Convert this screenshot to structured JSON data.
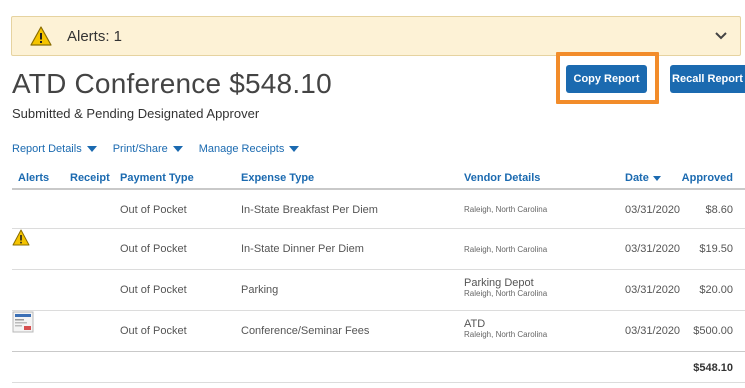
{
  "alerts": {
    "label": "Alerts: 1"
  },
  "report": {
    "title": "ATD Conference $548.10",
    "status": "Submitted & Pending Designated Approver"
  },
  "actions": {
    "copy": "Copy Report",
    "recall": "Recall Report"
  },
  "menus": [
    "Report Details",
    "Print/Share",
    "Manage Receipts"
  ],
  "columns": {
    "alerts": "Alerts",
    "receipt": "Receipt",
    "payment_type": "Payment Type",
    "expense_type": "Expense Type",
    "vendor": "Vendor Details",
    "date": "Date",
    "approved": "Approved"
  },
  "rows": [
    {
      "payment_type": "Out of Pocket",
      "expense_type": "In-State Breakfast Per Diem",
      "vendor_name": "",
      "vendor_loc": "Raleigh, North Carolina",
      "date": "03/31/2020",
      "amount": "$8.60"
    },
    {
      "payment_type": "Out of Pocket",
      "expense_type": "In-State Dinner Per Diem",
      "vendor_name": "",
      "vendor_loc": "Raleigh, North Carolina",
      "date": "03/31/2020",
      "amount": "$19.50"
    },
    {
      "payment_type": "Out of Pocket",
      "expense_type": "Parking",
      "vendor_name": "Parking Depot",
      "vendor_loc": "Raleigh, North Carolina",
      "date": "03/31/2020",
      "amount": "$20.00"
    },
    {
      "payment_type": "Out of Pocket",
      "expense_type": "Conference/Seminar Fees",
      "vendor_name": "ATD",
      "vendor_loc": "Raleigh, North Carolina",
      "date": "03/31/2020",
      "amount": "$500.00"
    }
  ],
  "total": "$548.10",
  "colors": {
    "brand_blue": "#1b6ab0",
    "highlight": "#f28c2a",
    "alert_bg": "#fdf2d6",
    "warning_yellow": "#f5c400"
  }
}
